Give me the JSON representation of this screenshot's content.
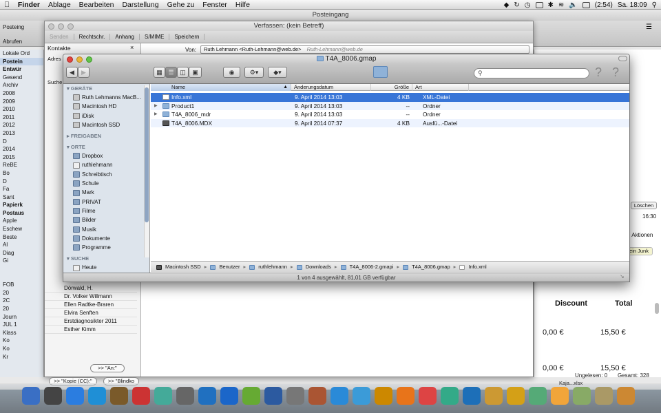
{
  "menubar": {
    "app": "Finder",
    "items": [
      "Ablage",
      "Bearbeiten",
      "Darstellung",
      "Gehe zu",
      "Fenster",
      "Hilfe"
    ],
    "battery": "(2:54)",
    "clock": "Sa. 18:09"
  },
  "mail": {
    "window_title": "Posteingang",
    "toolbar_label": "Abrufen",
    "inbox_tab": "Posteing",
    "sidebar": [
      {
        "t": "Lokale Ord",
        "b": false
      },
      {
        "t": "Postein",
        "b": true
      },
      {
        "t": "Entwür",
        "b": true
      },
      {
        "t": "Gesend",
        "b": false
      },
      {
        "t": "Archiv",
        "b": false
      },
      {
        "t": "2008",
        "b": false
      },
      {
        "t": "2009",
        "b": false
      },
      {
        "t": "2010",
        "b": false
      },
      {
        "t": "2011",
        "b": false
      },
      {
        "t": "2012",
        "b": false
      },
      {
        "t": "2013",
        "b": false
      },
      {
        "t": "D",
        "b": false
      },
      {
        "t": "2014",
        "b": false
      },
      {
        "t": "2015",
        "b": false
      },
      {
        "t": "ReBE",
        "b": false
      },
      {
        "t": "Bo",
        "b": false
      },
      {
        "t": "D",
        "b": false
      },
      {
        "t": "Fa",
        "b": false
      },
      {
        "t": "Sant",
        "b": false
      },
      {
        "t": "Papierk",
        "b": true
      },
      {
        "t": "Postaus",
        "b": true
      },
      {
        "t": "Apple",
        "b": false
      },
      {
        "t": "Eschew",
        "b": false
      },
      {
        "t": "Beste",
        "b": false
      },
      {
        "t": "Al",
        "b": false
      },
      {
        "t": "Diag",
        "b": false
      },
      {
        "t": "Gi",
        "b": false
      },
      {
        "t": "",
        "b": false
      },
      {
        "t": "",
        "b": false
      },
      {
        "t": "FOB",
        "b": false
      },
      {
        "t": "20",
        "b": false
      },
      {
        "t": "2C",
        "b": false
      },
      {
        "t": "20",
        "b": false
      },
      {
        "t": "Journ",
        "b": false
      },
      {
        "t": "JUL 1",
        "b": false
      },
      {
        "t": "Klass",
        "b": false
      },
      {
        "t": "Ko",
        "b": false
      },
      {
        "t": "Ko",
        "b": false
      },
      {
        "t": "Kr",
        "b": false
      }
    ],
    "delete_label": "Löschen",
    "time": "16:30",
    "actions": "e Aktionen",
    "junk": "ein Junk",
    "discount_header": "Discount",
    "total_header": "Total",
    "row1": {
      "discount": "0,00 €",
      "total": "15,50 €"
    },
    "row2": {
      "discount": "0,00 €",
      "total": "15,50 €"
    },
    "status_unread": "Ungelesen: 0",
    "status_total": "Gesamt: 328",
    "attachment": "Kaja...xlsx"
  },
  "compose": {
    "title": "Verfassen: (kein Betreff)",
    "toolbar": [
      "Senden",
      "Rechtschr.",
      "Anhang",
      "S/MIME",
      "Speichern"
    ],
    "contacts_title": "Kontakte",
    "addr_label": "Adres",
    "search_label": "Suche",
    "from_label": "Von:",
    "from_value": "Ruth Lehmann <Ruth-Lehmann@web.de>",
    "from_hint": "Ruth-Lehmann@web.de",
    "contacts": [
      "Dörwald, H.",
      "Dr. Volker Willmann",
      "Ellen Radtke-Braren",
      "Elvira Senften",
      "Erstdiagnosikter 2011",
      "Esther Kimm"
    ],
    "btn_to": ">> \"An:\"",
    "btn_cc": ">> \"Kopie (CC):\"",
    "btn_bcc": ">> \"Blindko"
  },
  "finder": {
    "title": "T4A_8006.gmap",
    "sidebar": {
      "devices_header": "GERÄTE",
      "devices": [
        "Ruth Lehmanns MacB...",
        "Macintosh HD",
        "iDisk",
        "Macintosh SSD"
      ],
      "shares_header": "FREIGABEN",
      "places_header": "ORTE",
      "places": [
        "Dropbox",
        "ruthlehmann",
        "Schreibtisch",
        "Schule",
        "Mark",
        "PRIVAT",
        "Filme",
        "Bilder",
        "Musik",
        "Dokumente",
        "Programme"
      ],
      "search_header": "SUCHE",
      "search_items": [
        "Heute"
      ]
    },
    "columns": {
      "name": "Name",
      "date": "Änderungsdatum",
      "size": "Größe",
      "kind": "Art"
    },
    "files": [
      {
        "name": "Info.xml",
        "date": "9. April 2014 13:03",
        "size": "4 KB",
        "kind": "XML-Datei",
        "type": "doc",
        "selected": true
      },
      {
        "name": "Product1",
        "date": "9. April 2014 13:03",
        "size": "--",
        "kind": "Ordner",
        "type": "folder",
        "selected": false
      },
      {
        "name": "T4A_8006_mdr",
        "date": "9. April 2014 13:03",
        "size": "--",
        "kind": "Ordner",
        "type": "folder",
        "selected": false
      },
      {
        "name": "T4A_8006.MDX",
        "date": "9. April 2014 07:37",
        "size": "4 KB",
        "kind": "Ausfü...-Datei",
        "type": "exe",
        "selected": false
      }
    ],
    "path": [
      "Macintosh SSD",
      "Benutzer",
      "ruthlehmann",
      "Downloads",
      "T4A_8006-2.gmapi",
      "T4A_8006.gmap",
      "Info.xml"
    ],
    "status": "1 von 4 ausgewählt, 81,01 GB verfügbar"
  },
  "colors": {
    "selection": "#3875d7",
    "sidebar": "#dde4ec"
  }
}
